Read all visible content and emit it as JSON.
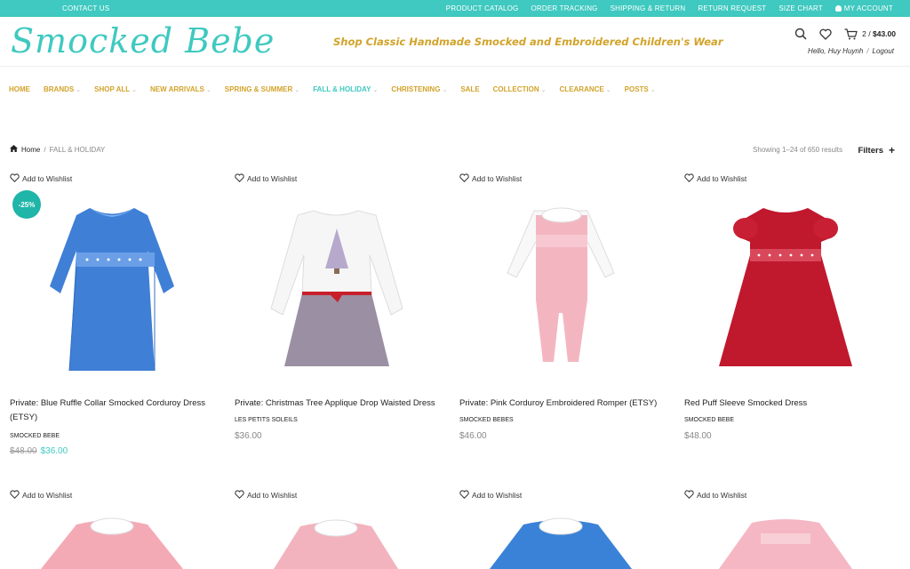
{
  "topbar": {
    "contact": "CONTACT US",
    "links": [
      "PRODUCT CATALOG",
      "ORDER TRACKING",
      "SHIPPING & RETURN",
      "RETURN REQUEST",
      "SIZE CHART",
      "MY ACCOUNT"
    ]
  },
  "header": {
    "logo": "Smocked Bebe",
    "tagline": "Shop Classic Handmade Smocked and Embroidered Children's Wear",
    "cart_count": "2",
    "cart_sep": " / ",
    "cart_total": "$43.00",
    "hello": "Hello, Huy Huynh",
    "hello_sep": "/",
    "logout": "Logout"
  },
  "nav": [
    {
      "label": "HOME",
      "dropdown": false,
      "active": false
    },
    {
      "label": "BRANDS",
      "dropdown": true,
      "active": false
    },
    {
      "label": "SHOP ALL",
      "dropdown": true,
      "active": false
    },
    {
      "label": "NEW ARRIVALS",
      "dropdown": true,
      "active": false
    },
    {
      "label": "SPRING & SUMMER",
      "dropdown": true,
      "active": false
    },
    {
      "label": "FALL & HOLIDAY",
      "dropdown": true,
      "active": true
    },
    {
      "label": "CHRISTENING",
      "dropdown": true,
      "active": false
    },
    {
      "label": "SALE",
      "dropdown": false,
      "active": false
    },
    {
      "label": "COLLECTION",
      "dropdown": true,
      "active": false
    },
    {
      "label": "CLEARANCE",
      "dropdown": true,
      "active": false
    },
    {
      "label": "POSTS",
      "dropdown": true,
      "active": false
    }
  ],
  "breadcrumb": {
    "home": "Home",
    "sep": "/",
    "current": "FALL & HOLIDAY"
  },
  "results_text": "Showing 1–24 of 650 results",
  "filters_label": "Filters",
  "wishlist_label": "Add to Wishlist",
  "products": [
    {
      "name": "Private: Blue Ruffle Collar Smocked Corduroy Dress (ETSY)",
      "brand": "SMOCKED BEBE",
      "old_price": "$48.00",
      "price": "$36.00",
      "badge": "-25%"
    },
    {
      "name": "Private: Christmas Tree Applique Drop Waisted Dress",
      "brand": "LES PETITS SOLEILS",
      "old_price": "",
      "price": "$36.00",
      "badge": ""
    },
    {
      "name": "Private: Pink Corduroy Embroidered Romper (ETSY)",
      "brand": "SMOCKED BEBES",
      "old_price": "",
      "price": "$46.00",
      "badge": ""
    },
    {
      "name": "Red Puff Sleeve Smocked Dress",
      "brand": "SMOCKED BEBE",
      "old_price": "",
      "price": "$48.00",
      "badge": ""
    }
  ],
  "colors": {
    "accent": "#3fc9c0",
    "gold": "#d2a32a",
    "badge": "#1fb5a8"
  }
}
